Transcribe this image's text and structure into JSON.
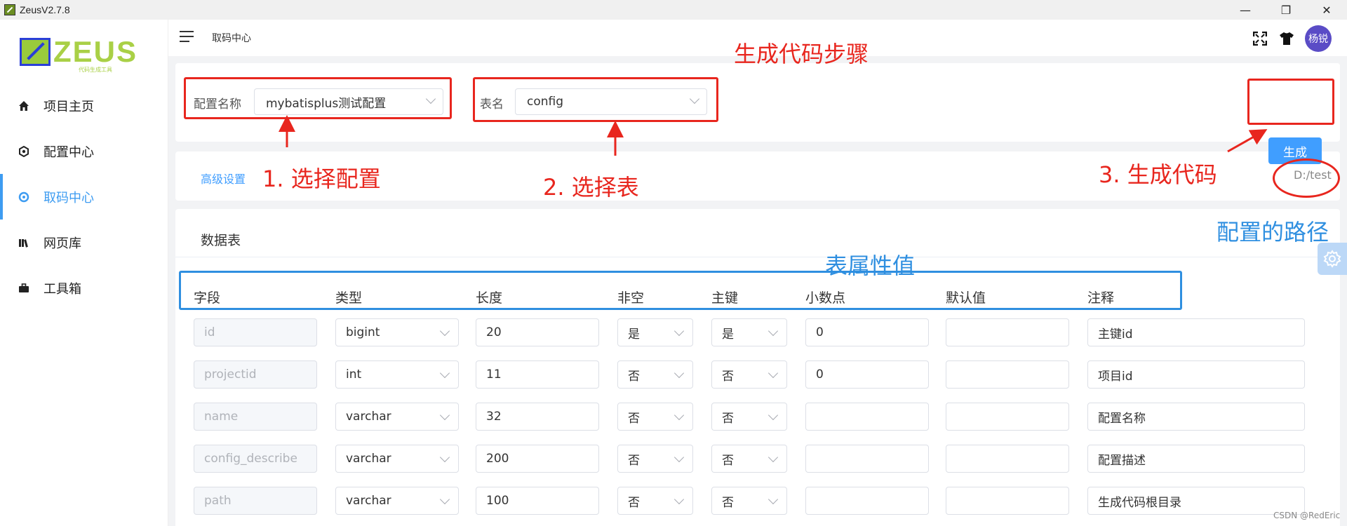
{
  "window": {
    "title": "ZeusV2.7.8",
    "controls": {
      "minimize": "—",
      "maximize": "❐",
      "close": "✕"
    }
  },
  "logo": {
    "text": "ZEUS",
    "subtitle": "代码生成工具"
  },
  "sidebar": {
    "items": [
      {
        "label": "项目主页",
        "icon": "home-icon"
      },
      {
        "label": "配置中心",
        "icon": "settings-hex-icon"
      },
      {
        "label": "取码中心",
        "icon": "target-icon",
        "active": true
      },
      {
        "label": "网页库",
        "icon": "library-icon"
      },
      {
        "label": "工具箱",
        "icon": "toolbox-icon"
      }
    ]
  },
  "header": {
    "breadcrumb": "取码中心",
    "avatar": "杨锐",
    "icons": [
      "fullscreen-icon",
      "theme-shirt-icon"
    ]
  },
  "config_bar": {
    "config_label": "配置名称",
    "config_value": "mybatisplus测试配置",
    "table_label": "表名",
    "table_value": "config",
    "generate_label": "生成"
  },
  "advanced": {
    "link": "高级设置",
    "path": "D:/test"
  },
  "table": {
    "title": "数据表",
    "headers": [
      "字段",
      "类型",
      "长度",
      "非空",
      "主键",
      "小数点",
      "默认值",
      "注释"
    ],
    "rows": [
      {
        "field": "id",
        "type": "bigint",
        "length": "20",
        "not_null": "是",
        "primary": "是",
        "decimal": "0",
        "default": "",
        "comment": "主键id"
      },
      {
        "field": "projectid",
        "type": "int",
        "length": "11",
        "not_null": "否",
        "primary": "否",
        "decimal": "0",
        "default": "",
        "comment": "项目id"
      },
      {
        "field": "name",
        "type": "varchar",
        "length": "32",
        "not_null": "否",
        "primary": "否",
        "decimal": "",
        "default": "",
        "comment": "配置名称"
      },
      {
        "field": "config_describe",
        "type": "varchar",
        "length": "200",
        "not_null": "否",
        "primary": "否",
        "decimal": "",
        "default": "",
        "comment": "配置描述"
      },
      {
        "field": "path",
        "type": "varchar",
        "length": "100",
        "not_null": "否",
        "primary": "否",
        "decimal": "",
        "default": "",
        "comment": "生成代码根目录"
      }
    ]
  },
  "annotations": {
    "title": "生成代码步骤",
    "step1": "1. 选择配置",
    "step2": "2. 选择表",
    "step3": "3. 生成代码",
    "path_note": "配置的路径",
    "attr_note": "表属性值"
  },
  "watermark": "CSDN @RedEric",
  "colors": {
    "accent": "#409eff",
    "annotation_red": "#e8261e",
    "annotation_blue": "#2f8fe0",
    "avatar": "#5a4cc6"
  }
}
